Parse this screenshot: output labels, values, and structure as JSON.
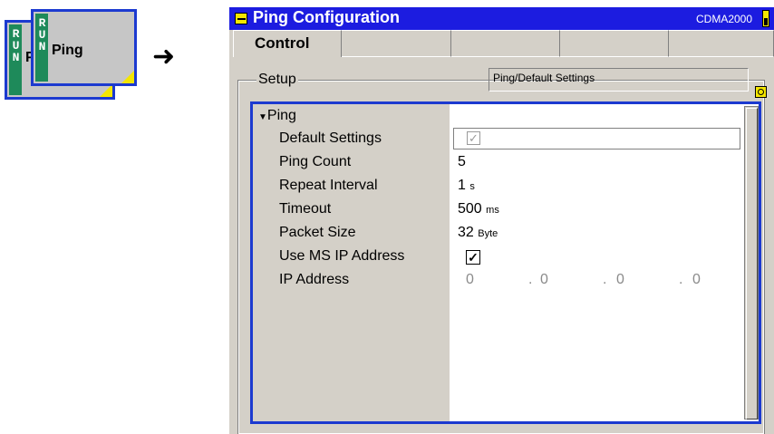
{
  "softkey": {
    "run_text": "RUN",
    "label_back": "P",
    "label": "Ping"
  },
  "arrow_glyph": "➜",
  "window": {
    "title": "Ping Configuration",
    "standard": "CDMA2000",
    "tabs": [
      "Control",
      "",
      "",
      "",
      ""
    ],
    "setup_label": "Setup",
    "setup_field": "Ping/Default Settings",
    "tree_header": "Ping",
    "rows": [
      {
        "label": "Default Settings",
        "value": "",
        "unit": "",
        "kind": "checkbox-greyed"
      },
      {
        "label": "Ping Count",
        "value": "5",
        "unit": "",
        "kind": "value"
      },
      {
        "label": "Repeat Interval",
        "value": "1",
        "unit": "s",
        "kind": "value"
      },
      {
        "label": "Timeout",
        "value": "500",
        "unit": "ms",
        "kind": "value"
      },
      {
        "label": "Packet Size",
        "value": "32",
        "unit": "Byte",
        "kind": "value"
      },
      {
        "label": "Use MS IP Address",
        "value": "",
        "unit": "",
        "kind": "checkbox"
      },
      {
        "label": "IP Address",
        "value": "",
        "unit": "",
        "kind": "ip"
      }
    ],
    "ip_octets": [
      "0",
      "0",
      "0",
      "0"
    ],
    "ip_separator": "."
  },
  "colors": {
    "titlebar": "#1c1ce0",
    "frame": "#1c3ad0",
    "run_green": "#1e8a5a",
    "accent_yellow": "#f4e600"
  }
}
